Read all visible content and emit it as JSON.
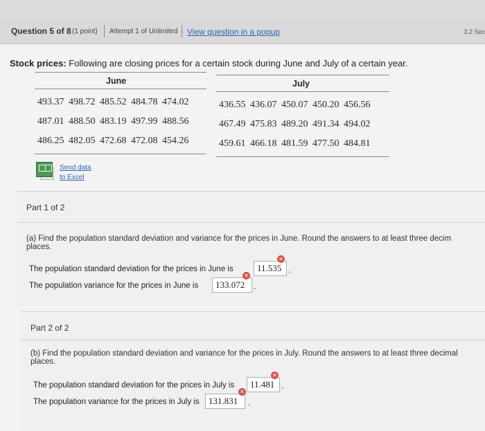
{
  "header": {
    "question_label": "Question 5 of 8",
    "points": "(1 point)",
    "attempt": "Attempt 1 of Unlimited",
    "popup_link": "View question in a popup",
    "timer": "3.2 Sec"
  },
  "prompt": {
    "lead": "Stock prices:",
    "text": "Following are closing prices for a certain stock during June and July of a certain year."
  },
  "tables": {
    "june": {
      "title": "June",
      "rows": [
        "493.37 498.72 485.52 484.78 474.02",
        "487.01 488.50 483.19 497.99 488.56",
        "486.25 482.05 472.68 472.08 454.26"
      ]
    },
    "july": {
      "title": "July",
      "rows": [
        "436.55 436.07 450.07 450.20 456.56",
        "467.49 475.83 489.20 491.34 494.02",
        "459.61 466.18 481.59 477.50 484.81"
      ]
    }
  },
  "excel": {
    "line1": "Send data",
    "line2": "to Excel"
  },
  "part1": {
    "label": "Part 1 of 2",
    "question_line1": "(a) Find the population standard deviation and variance for the prices in June. Round the answers to at least three decim",
    "question_line2": "places.",
    "sd_label": "The population standard deviation for the prices in June is",
    "sd_value": "11.535",
    "var_label": "The population variance for the prices in June is",
    "var_value": "133.072"
  },
  "part2": {
    "label": "Part 2 of 2",
    "question_line1": "(b) Find the population standard deviation and variance for the prices in July. Round the answers to at least three decimal",
    "question_line2": "places.",
    "sd_label": "The population standard deviation for the prices in July is",
    "sd_value": "11.481",
    "var_label": "The population variance for the prices in July is",
    "var_value": "131.831"
  },
  "marks": {
    "incorrect_glyph": "✕",
    "period": "."
  },
  "colors": {
    "link": "#2e63b5",
    "incorrect": "#d9534f",
    "answer_border": "#9ab7b0"
  }
}
